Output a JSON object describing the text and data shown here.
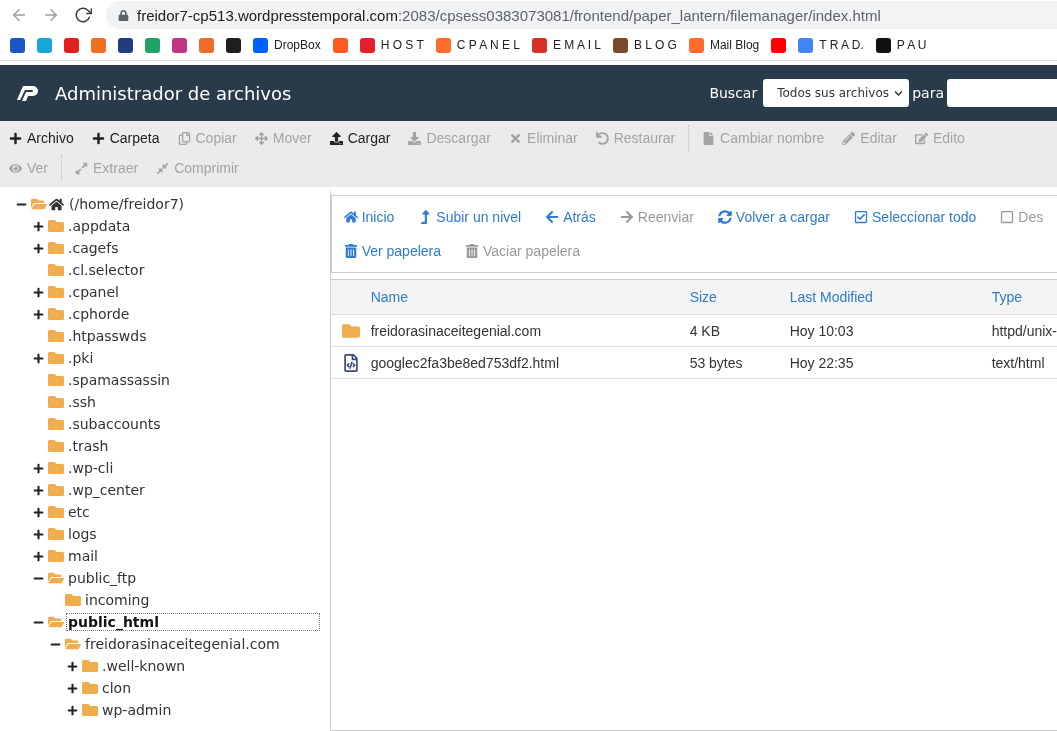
{
  "browser": {
    "url_host": "freidor7-cp513.wordpresstemporal.com",
    "url_path": ":2083/cpsess0383073081/frontend/paper_lantern/filemanager/index.html",
    "bookmarks": [
      {
        "color": "#1a56c4"
      },
      {
        "color": "#17a8d8"
      },
      {
        "color": "#e0201c"
      },
      {
        "color": "#f07020"
      },
      {
        "color": "#253b80"
      },
      {
        "color": "#1fa463"
      },
      {
        "color": "#c13584"
      },
      {
        "color": "#ef6c2a"
      },
      {
        "color": "#1e1e1e"
      },
      {
        "label": "DropBox",
        "color": "#0061fe"
      },
      {
        "color": "#ff5a1f"
      },
      {
        "label": "H O S T",
        "color": "#e4202f"
      },
      {
        "label": "C P A N E L",
        "color": "#ff6c2c"
      },
      {
        "label": "E M A I L",
        "color": "#d93025"
      },
      {
        "label": "B L O G",
        "color": "#7a4a2a"
      },
      {
        "label": "Mail Blog",
        "color": "#ff6c2c"
      },
      {
        "color": "#ff0000"
      },
      {
        "label": "T R A D.",
        "color": "#4285f4"
      },
      {
        "label": "P A U",
        "color": "#111111"
      }
    ]
  },
  "header": {
    "title": "Administrador de archivos",
    "search_label": "Buscar",
    "search_scope": "Todos sus archivos",
    "for_label": "para"
  },
  "toolbar": [
    [
      [
        {
          "label": "Archivo",
          "disabled": false
        },
        {
          "label": "Carpeta",
          "disabled": false
        },
        {
          "label": "Copiar",
          "disabled": true
        },
        {
          "label": "Mover",
          "disabled": true
        },
        {
          "label": "Cargar",
          "disabled": false
        },
        {
          "label": "Descargar",
          "disabled": true
        },
        {
          "label": "Eliminar",
          "disabled": true
        },
        {
          "label": "Restaurar",
          "disabled": true
        }
      ],
      [
        {
          "label": "Cambiar nombre",
          "disabled": true
        },
        {
          "label": "Editar",
          "disabled": true
        },
        {
          "label": "Edito",
          "disabled": true
        }
      ]
    ],
    [
      [
        {
          "label": "Ver",
          "disabled": true
        }
      ],
      [
        {
          "label": "Extraer",
          "disabled": true
        },
        {
          "label": "Comprimir",
          "disabled": true
        }
      ]
    ]
  ],
  "tree": {
    "label": "(/home/freidor7)",
    "expanded": true,
    "selected": false,
    "children": [
      {
        "label": ".appdata",
        "expanded": false,
        "expandable": true,
        "selected": false
      },
      {
        "label": ".cagefs",
        "expanded": false,
        "expandable": true,
        "selected": false
      },
      {
        "label": ".cl.selector",
        "expanded": false,
        "expandable": false,
        "selected": false
      },
      {
        "label": ".cpanel",
        "expanded": false,
        "expandable": true,
        "selected": false
      },
      {
        "label": ".cphorde",
        "expanded": false,
        "expandable": true,
        "selected": false
      },
      {
        "label": ".htpasswds",
        "expanded": false,
        "expandable": false,
        "selected": false
      },
      {
        "label": ".pki",
        "expanded": false,
        "expandable": true,
        "selected": false
      },
      {
        "label": ".spamassassin",
        "expanded": false,
        "expandable": false,
        "selected": false
      },
      {
        "label": ".ssh",
        "expanded": false,
        "expandable": false,
        "selected": false
      },
      {
        "label": ".subaccounts",
        "expanded": false,
        "expandable": false,
        "selected": false
      },
      {
        "label": ".trash",
        "expanded": false,
        "expandable": false,
        "selected": false
      },
      {
        "label": ".wp-cli",
        "expanded": false,
        "expandable": true,
        "selected": false
      },
      {
        "label": ".wp_center",
        "expanded": false,
        "expandable": true,
        "selected": false
      },
      {
        "label": "etc",
        "expanded": false,
        "expandable": true,
        "selected": false
      },
      {
        "label": "logs",
        "expanded": false,
        "expandable": true,
        "selected": false
      },
      {
        "label": "mail",
        "expanded": false,
        "expandable": true,
        "selected": false
      },
      {
        "label": "public_ftp",
        "expanded": true,
        "expandable": true,
        "selected": false,
        "children": [
          {
            "label": "incoming",
            "expanded": false,
            "expandable": false,
            "selected": false
          }
        ]
      },
      {
        "label": "public_html",
        "expanded": true,
        "expandable": true,
        "selected": true,
        "children": [
          {
            "label": "freidorasinaceitegenial.com",
            "expanded": true,
            "expandable": true,
            "selected": false,
            "children": [
              {
                "label": ".well-known",
                "expanded": false,
                "expandable": true,
                "selected": false
              },
              {
                "label": "clon",
                "expanded": false,
                "expandable": true,
                "selected": false
              },
              {
                "label": "wp-admin",
                "expanded": false,
                "expandable": true,
                "selected": false
              }
            ]
          }
        ]
      }
    ]
  },
  "nav": [
    [
      {
        "kind": "home",
        "label": "Inicio",
        "disabled": false
      },
      {
        "kind": "up",
        "label": "Subir un nivel",
        "disabled": false
      },
      {
        "kind": "back",
        "label": "Atrás",
        "disabled": false
      },
      {
        "kind": "forward",
        "label": "Reenviar",
        "disabled": true
      },
      {
        "kind": "reload",
        "label": "Volver a cargar",
        "disabled": false
      },
      {
        "kind": "select",
        "label": "Seleccionar todo",
        "disabled": false
      },
      {
        "kind": "deselect",
        "label": "Des",
        "disabled": true
      }
    ],
    [
      {
        "kind": "trash",
        "label": "Ver papelera",
        "disabled": false
      },
      {
        "kind": "trash",
        "label": "Vaciar papelera",
        "disabled": true
      }
    ]
  ],
  "table": {
    "columns": [
      "Name",
      "Size",
      "Last Modified",
      "Type"
    ],
    "rows": [
      {
        "kind": "folder",
        "name": "freidorasinaceitegenial.com",
        "size": "4 KB",
        "modified": "Hoy 10:03",
        "type": "httpd/unix-"
      },
      {
        "kind": "file",
        "name": "googlec2fa3be8ed753df2.html",
        "size": "53 bytes",
        "modified": "Hoy 22:35",
        "type": "text/html"
      }
    ]
  }
}
